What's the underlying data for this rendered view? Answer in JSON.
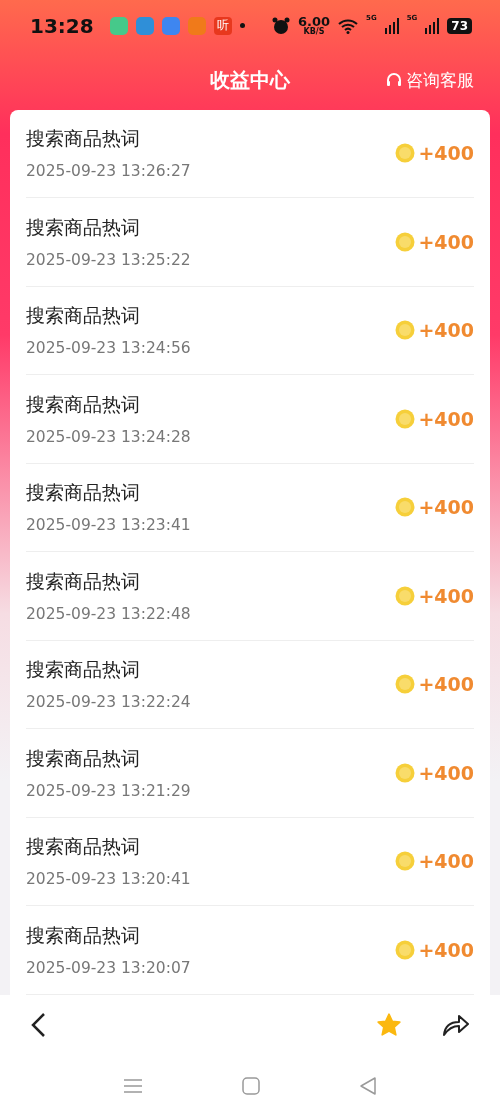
{
  "status_bar": {
    "time": "13:28",
    "app_badge": "听",
    "speed": "6.00",
    "speed_unit": "KB/S",
    "network_1": "5G",
    "network_2": "5G",
    "battery": "73"
  },
  "header": {
    "title": "收益中心",
    "support": "咨询客服"
  },
  "records": [
    {
      "title": "搜索商品热词",
      "time": "2025-09-23 13:26:27",
      "reward": "+400"
    },
    {
      "title": "搜索商品热词",
      "time": "2025-09-23 13:25:22",
      "reward": "+400"
    },
    {
      "title": "搜索商品热词",
      "time": "2025-09-23 13:24:56",
      "reward": "+400"
    },
    {
      "title": "搜索商品热词",
      "time": "2025-09-23 13:24:28",
      "reward": "+400"
    },
    {
      "title": "搜索商品热词",
      "time": "2025-09-23 13:23:41",
      "reward": "+400"
    },
    {
      "title": "搜索商品热词",
      "time": "2025-09-23 13:22:48",
      "reward": "+400"
    },
    {
      "title": "搜索商品热词",
      "time": "2025-09-23 13:22:24",
      "reward": "+400"
    },
    {
      "title": "搜索商品热词",
      "time": "2025-09-23 13:21:29",
      "reward": "+400"
    },
    {
      "title": "搜索商品热词",
      "time": "2025-09-23 13:20:41",
      "reward": "+400"
    },
    {
      "title": "搜索商品热词",
      "time": "2025-09-23 13:20:07",
      "reward": "+400"
    }
  ],
  "toolbar": {
    "favorite": true
  }
}
